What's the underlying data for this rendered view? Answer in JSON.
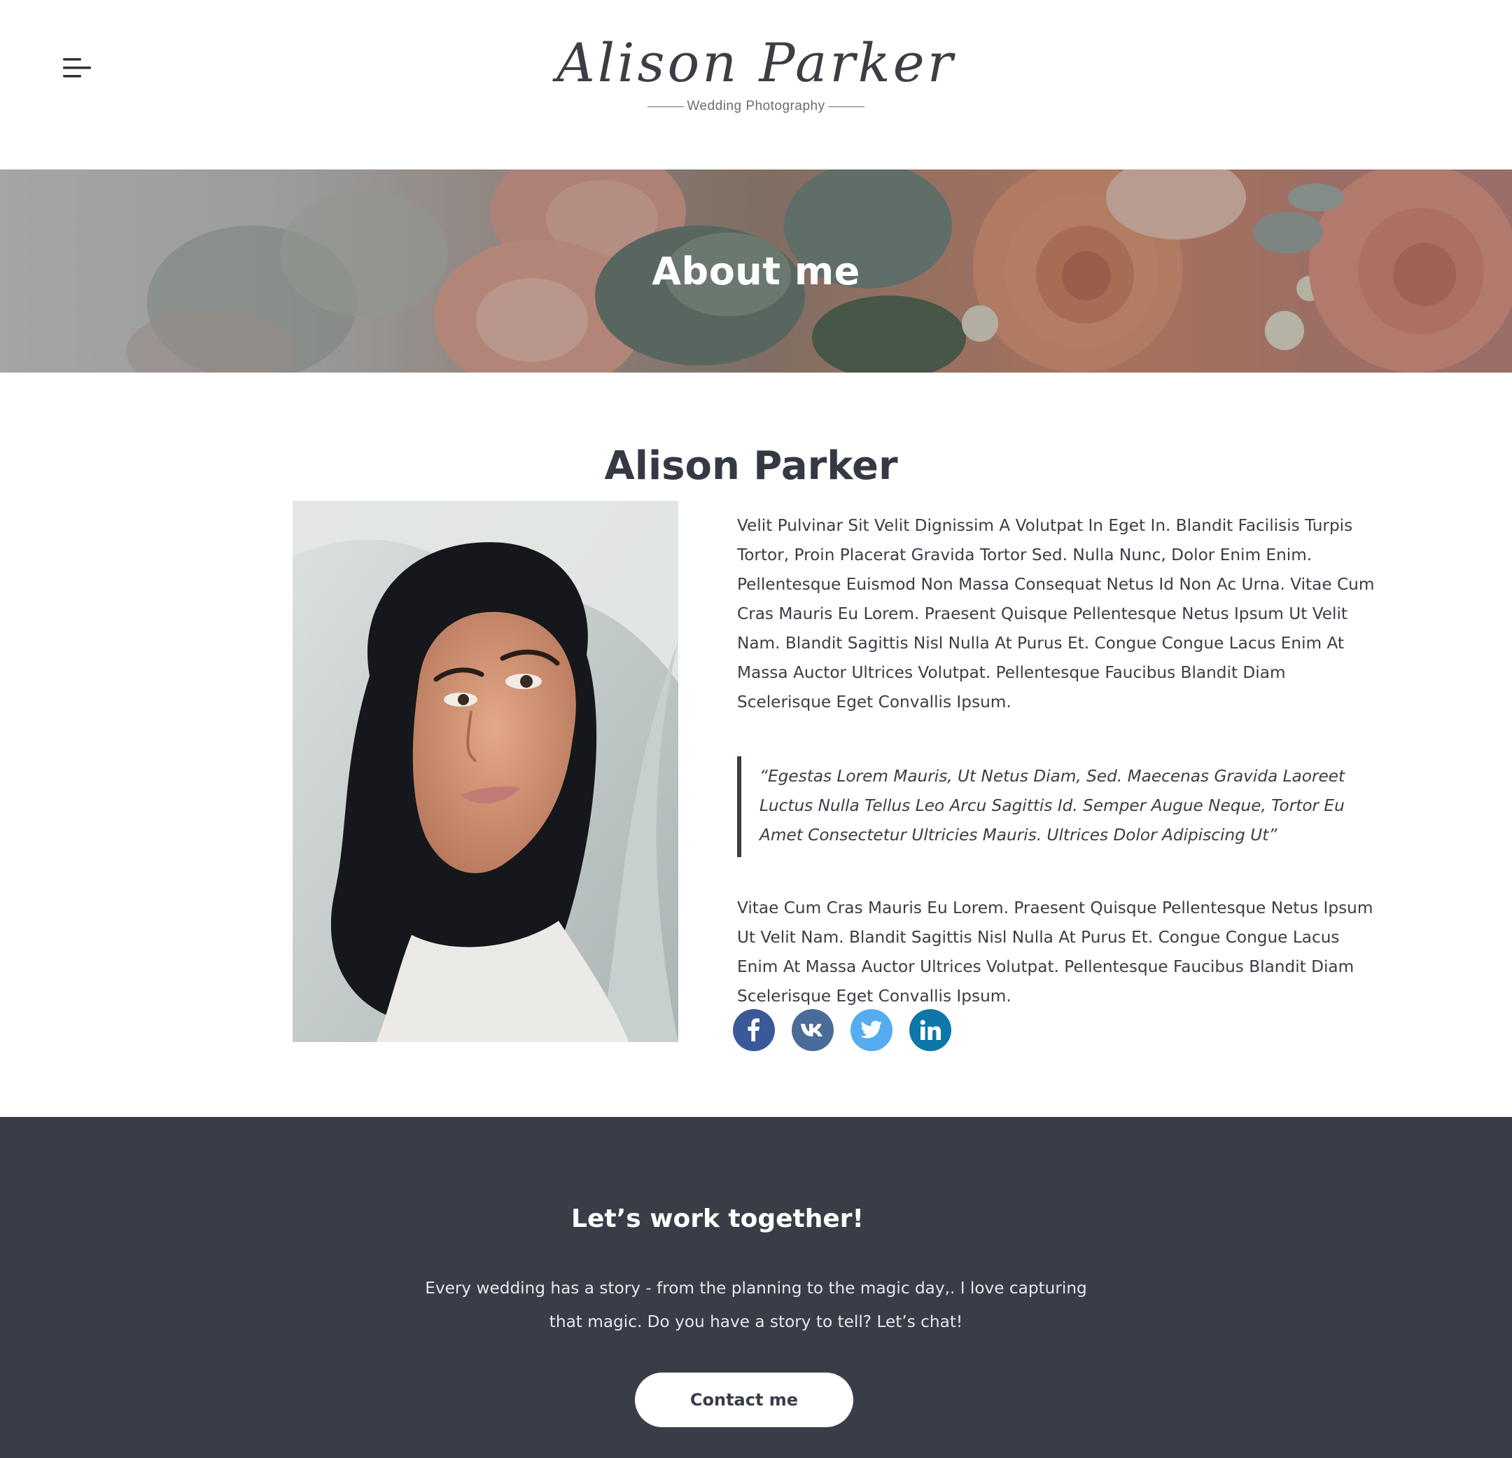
{
  "header": {
    "menu_icon": "menu-icon",
    "logo_name": "Alison Parker",
    "logo_tagline": "Wedding Photography"
  },
  "hero": {
    "title": "About me"
  },
  "about": {
    "name": "Alison Parker",
    "paragraph_1": "Velit Pulvinar Sit Velit Dignissim A Volutpat In Eget In. Blandit Facilisis Turpis Tortor, Proin Placerat Gravida Tortor Sed. Nulla Nunc, Dolor Enim Enim. Pellentesque Euismod Non Massa Consequat Netus Id Non Ac Urna. Vitae Cum Cras Mauris Eu Lorem. Praesent Quisque Pellentesque Netus Ipsum Ut Velit Nam. Blandit Sagittis Nisl Nulla At Purus Et. Congue Congue Lacus Enim At Massa Auctor Ultrices Volutpat. Pellentesque Faucibus Blandit Diam Scelerisque Eget Convallis Ipsum.",
    "quote": "“Egestas Lorem Mauris, Ut Netus Diam, Sed. Maecenas Gravida Laoreet Luctus Nulla Tellus Leo Arcu Sagittis Id. Semper Augue Neque, Tortor Eu Amet Consectetur Ultricies Mauris. Ultrices Dolor Adipiscing Ut”",
    "paragraph_2": "Vitae Cum Cras Mauris Eu Lorem. Praesent Quisque Pellentesque Netus Ipsum Ut Velit Nam. Blandit Sagittis Nisl Nulla At Purus Et. Congue Congue Lacus Enim At Massa Auctor Ultrices Volutpat. Pellentesque Faucibus Blandit Diam Scelerisque Eget Convallis Ipsum.",
    "socials": [
      {
        "icon": "facebook-icon",
        "color": "#3b5998"
      },
      {
        "icon": "vk-icon",
        "color": "#4a6c99"
      },
      {
        "icon": "twitter-icon",
        "color": "#55acee"
      },
      {
        "icon": "linkedin-icon",
        "color": "#0e76a8"
      }
    ]
  },
  "cta": {
    "title": "Let’s work together!",
    "text": "Every wedding has a story - from the planning to the magic day,. I love capturing that magic. Do you have a story to tell? Let’s chat!",
    "button_label": "Contact me"
  },
  "colors": {
    "dark": "#393d47",
    "white": "#ffffff"
  }
}
